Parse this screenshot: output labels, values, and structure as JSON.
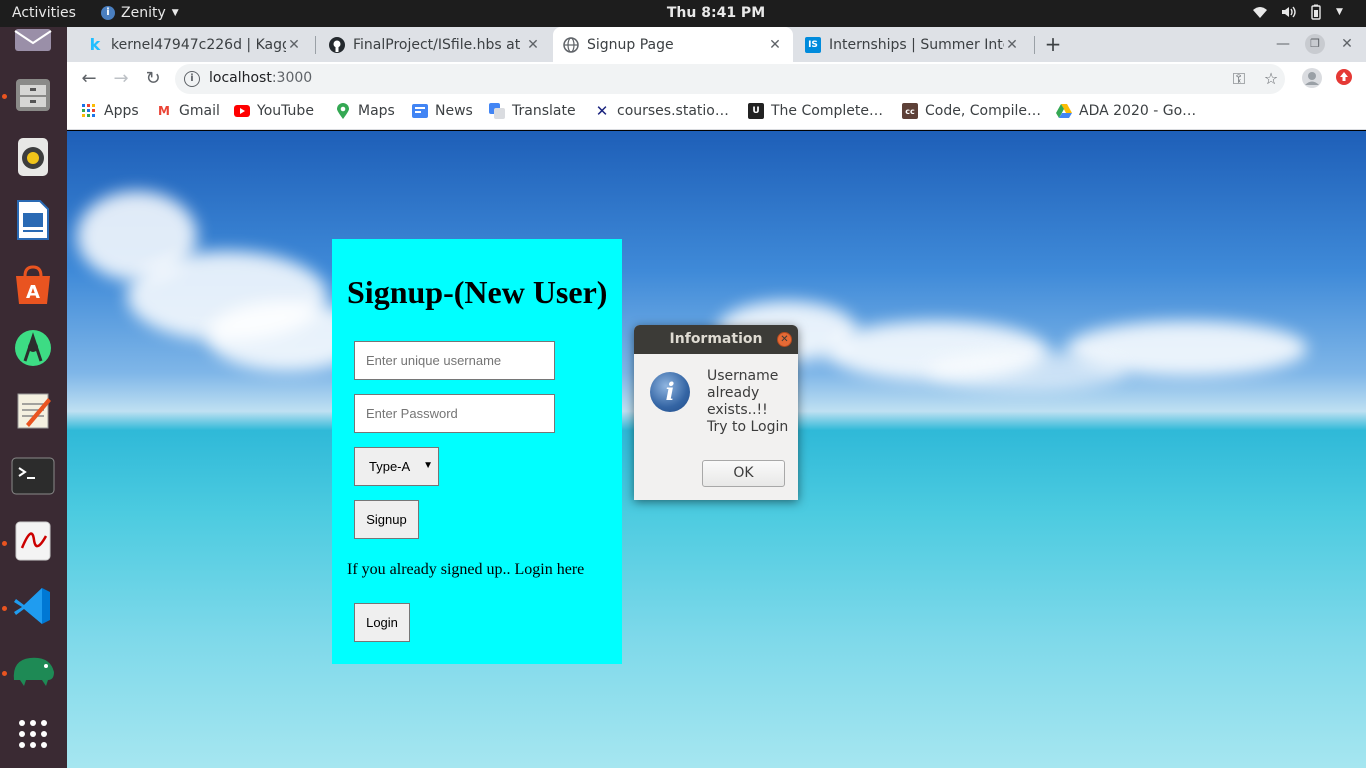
{
  "topbar": {
    "activities": "Activities",
    "app_name": "Zenity",
    "clock": "Thu  8:41 PM"
  },
  "tabs": [
    {
      "title": "kernel47947c226d | Kaggle",
      "favicon": "kaggle-icon"
    },
    {
      "title": "FinalProject/ISfile.hbs at master",
      "favicon": "github-icon"
    },
    {
      "title": "Signup Page",
      "favicon": "globe-icon",
      "active": true
    },
    {
      "title": "Internships | Summer Internships",
      "favicon": "internshala-icon"
    }
  ],
  "toolbar": {
    "url_host": "localhost",
    "url_port": ":3000"
  },
  "bookmarks": [
    {
      "label": "Apps",
      "icon": "apps-grid-icon"
    },
    {
      "label": "Gmail",
      "icon": "gmail-icon"
    },
    {
      "label": "YouTube",
      "icon": "youtube-icon"
    },
    {
      "label": "Maps",
      "icon": "maps-icon"
    },
    {
      "label": "News",
      "icon": "news-icon"
    },
    {
      "label": "Translate",
      "icon": "translate-icon"
    },
    {
      "label": "courses.statio…",
      "icon": "x-icon"
    },
    {
      "label": "The Complete…",
      "icon": "udemy-icon"
    },
    {
      "label": "Code, Compile…",
      "icon": "cc-icon"
    },
    {
      "label": "ADA 2020 - Go…",
      "icon": "drive-icon"
    }
  ],
  "signup": {
    "heading": "Signup-(New User)",
    "username_placeholder": "Enter unique username",
    "password_placeholder": "Enter Password",
    "type_selected": "Type-A",
    "signup_label": "Signup",
    "login_prompt": "If you already signed up.. Login here",
    "login_label": "Login",
    "background_color": "#00ffff"
  },
  "dialog": {
    "title": "Information",
    "message_lines": [
      "Username",
      "already",
      "exists..!!",
      "Try to Login"
    ],
    "ok_label": "OK"
  }
}
